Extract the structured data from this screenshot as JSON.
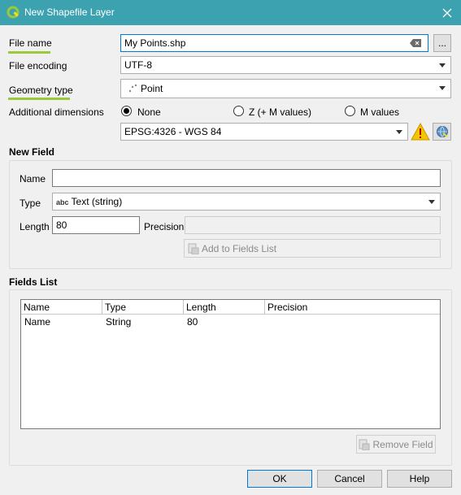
{
  "window": {
    "title": "New Shapefile Layer",
    "close_icon": "close-icon"
  },
  "form": {
    "file_name_label": "File name",
    "file_name_value": "My Points.shp",
    "browse_label": "...",
    "file_encoding_label": "File encoding",
    "file_encoding_value": "UTF-8",
    "geometry_type_label": "Geometry type",
    "geometry_type_value": "Point",
    "additional_dimensions_label": "Additional dimensions",
    "dim_none": "None",
    "dim_zm": "Z (+ M values)",
    "dim_m": "M values",
    "crs_value": "EPSG:4326 - WGS 84"
  },
  "new_field": {
    "title": "New Field",
    "name_label": "Name",
    "name_value": "",
    "type_label": "Type",
    "type_value": "Text (string)",
    "type_badge": "abc",
    "length_label": "Length",
    "length_value": "80",
    "precision_label": "Precision",
    "precision_value": "",
    "add_button": "Add to Fields List"
  },
  "fields_list": {
    "title": "Fields List",
    "columns": [
      "Name",
      "Type",
      "Length",
      "Precision"
    ],
    "rows": [
      {
        "name": "Name",
        "type": "String",
        "length": "80",
        "precision": ""
      }
    ],
    "remove_button": "Remove Field"
  },
  "buttons": {
    "ok": "OK",
    "cancel": "Cancel",
    "help": "Help"
  },
  "colors": {
    "titlebar": "#3ca2b0",
    "accent_underline": "#9bc93b",
    "focus": "#0078d7",
    "warning": "#f4c400"
  }
}
